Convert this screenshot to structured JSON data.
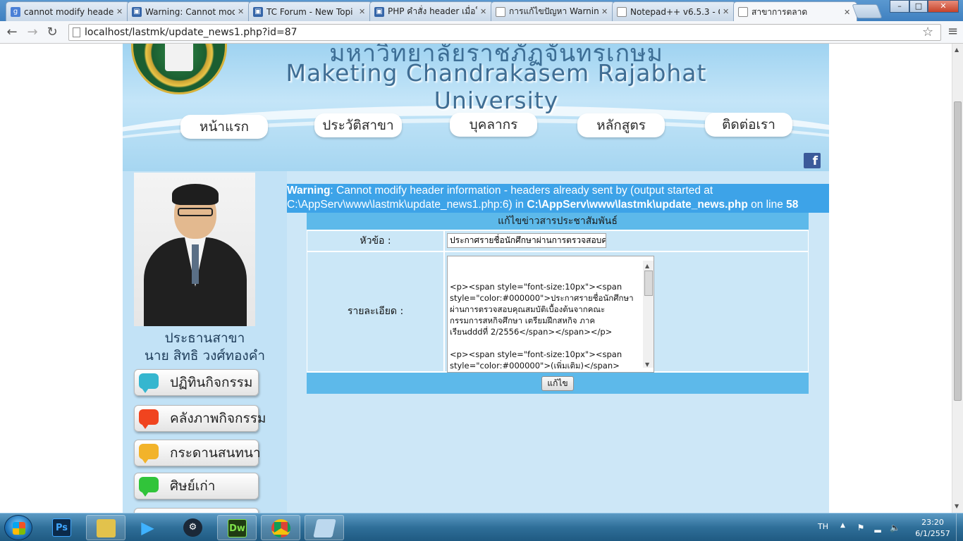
{
  "browser": {
    "tabs": [
      {
        "label": "cannot modify header",
        "fav": "g",
        "fav_color": "#4a7fd6"
      },
      {
        "label": "Warning: Cannot mod",
        "fav": "▣",
        "fav_color": "#3565a8"
      },
      {
        "label": "TC Forum - New Topi",
        "fav": "▣",
        "fav_color": "#3565a8"
      },
      {
        "label": "PHP คำสั่ง header เมื่อใ",
        "fav": "▣",
        "fav_color": "#3565a8"
      },
      {
        "label": "การแก้ไขปัญหา Warnin",
        "fav": "",
        "fav_color": "#ffffff"
      },
      {
        "label": "Notepad++ v6.5.3 - C",
        "fav": "",
        "fav_color": "#ffffff"
      },
      {
        "label": "สาขาการตลาด",
        "fav": "",
        "fav_color": "#ffffff"
      }
    ],
    "tab_close": "✕",
    "url": "localhost/lastmk/update_news1.php?id=87",
    "back": "←",
    "forward": "→",
    "reload": "↻",
    "star": "☆",
    "menu": "≡",
    "minimize": "–",
    "maximize": "□",
    "close": "✕"
  },
  "site": {
    "title_th": "มหาวิทยาลัยราชภัฏจันทรเกษม",
    "title_en": "Maketing Chandrakasem Rajabhat University",
    "nav": [
      {
        "label": "หน้าแรก"
      },
      {
        "label": "ประวัติสาขา"
      },
      {
        "label": "บุคลากร"
      },
      {
        "label": "หลักสูตร"
      },
      {
        "label": "ติดต่อเรา"
      }
    ],
    "facebook": "f"
  },
  "sidebar": {
    "role": "ประธานสาขา",
    "name": "นาย สิทธิ วงศ์ทองคำ",
    "buttons": [
      {
        "label": "ปฏิทินกิจกรรม",
        "color": "#35b6cf"
      },
      {
        "label": "คลังภาพกิจกรรม",
        "color": "#f0441f"
      },
      {
        "label": "กระดานสนทนา",
        "color": "#f2b32a"
      },
      {
        "label": "ศิษย์เก่า",
        "color": "#31c43a"
      }
    ]
  },
  "warning": {
    "prefix": "Warning",
    "line1": ": Cannot modify header information - headers already sent by (output started at",
    "line2a": "C:\\AppServ\\www\\lastmk\\update_news1.php:6) in ",
    "file": "C:\\AppServ\\www\\lastmk\\update_news.php",
    "online": " on line ",
    "line_no": "58"
  },
  "form": {
    "title": "แก้ไขข่าวสารประชาสัมพันธ์",
    "topic_label": "หัวข้อ :",
    "topic_value": "ประกาศรายชื่อนักศึกษาผ่านการตรวจสอบค",
    "detail_label": "รายละเอียด :",
    "detail_value": "<p><span style=\"font-size:10px\"><span\nstyle=\"color:#000000\">ประกาศรายชื่อนักศึกษา\nผ่านการตรวจสอบคุณสมบัติเบื้องต้นจากคณะ\nกรรมการสหกิจศึกษา เตรียมฝึกสหกิจ ภาค\nเรียนdddที่ 2/2556</span></span></p>\n\n<p><span style=\"font-size:10px\"><span\nstyle=\"color:#000000\">(เพิ่มเติม)</span>\n</span></p>",
    "submit": "แก้ไข"
  },
  "taskbar": {
    "lang": "TH",
    "time": "23:20",
    "date": "6/1/2557",
    "apps": [
      {
        "name": "photoshop",
        "text": "Ps",
        "bg": "#0b2a4a",
        "fg": "#3fa6ff"
      },
      {
        "name": "explorer",
        "text": "",
        "bg": "#e2c24c",
        "fg": "#ffffff"
      },
      {
        "name": "media-player",
        "text": "▶",
        "bg": "transparent",
        "fg": "#3fb2ff"
      },
      {
        "name": "steam",
        "text": "⚙",
        "bg": "#1b2838",
        "fg": "#ffffff"
      },
      {
        "name": "dreamweaver",
        "text": "Dw",
        "bg": "#1f3b12",
        "fg": "#7ee04a"
      },
      {
        "name": "chrome",
        "text": "",
        "bg": "transparent",
        "fg": "#ffffff"
      },
      {
        "name": "notepad",
        "text": "",
        "bg": "#bcd8ee",
        "fg": "#ffffff"
      }
    ]
  }
}
